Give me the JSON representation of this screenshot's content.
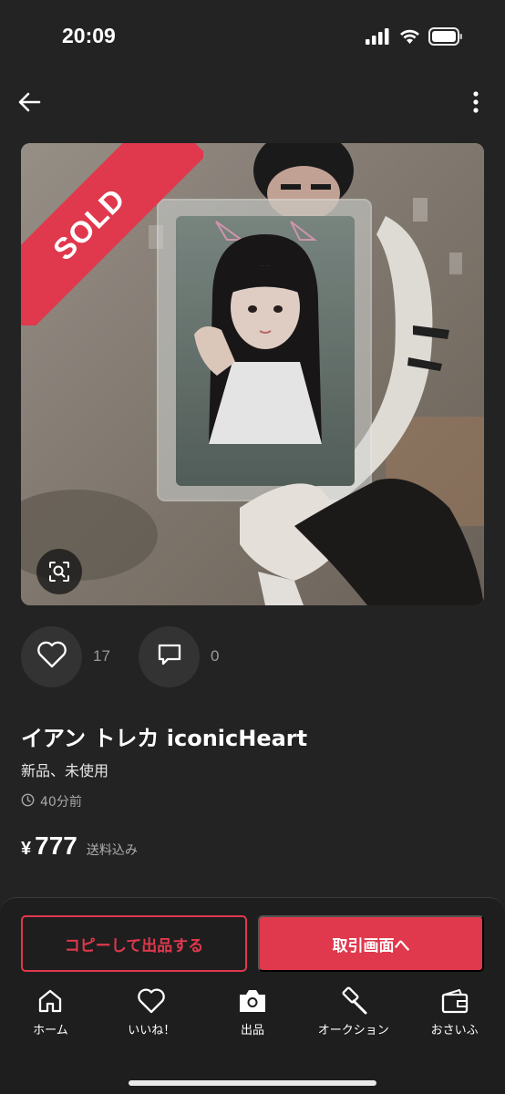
{
  "status_bar": {
    "time": "20:09",
    "icons": [
      "cellular-signal-icon",
      "wifi-icon",
      "battery-icon"
    ]
  },
  "nav": {
    "icons": [
      "back-arrow-icon",
      "more-vertical-icon"
    ]
  },
  "item": {
    "sold_badge": "SOLD",
    "title": "イアン トレカ iconicHeart",
    "condition": "新品、未使用",
    "posted": "40分前",
    "currency": "¥",
    "price": "777",
    "shipping": "送料込み",
    "likes": "17",
    "comments": "0"
  },
  "buttons": {
    "copy_listing": "コピーして出品する",
    "go_to_trade": "取引画面へ"
  },
  "tab_bar": [
    {
      "label": "ホーム",
      "icon": "home-icon"
    },
    {
      "label": "いいね！",
      "icon": "heart-icon"
    },
    {
      "label": "出品",
      "icon": "camera-icon"
    },
    {
      "label": "オークション",
      "icon": "gavel-icon"
    },
    {
      "label": "おさいふ",
      "icon": "wallet-icon"
    }
  ],
  "colors": {
    "background": "#232323",
    "accent": "#e0384d",
    "muted_text": "#9a9a9a"
  }
}
